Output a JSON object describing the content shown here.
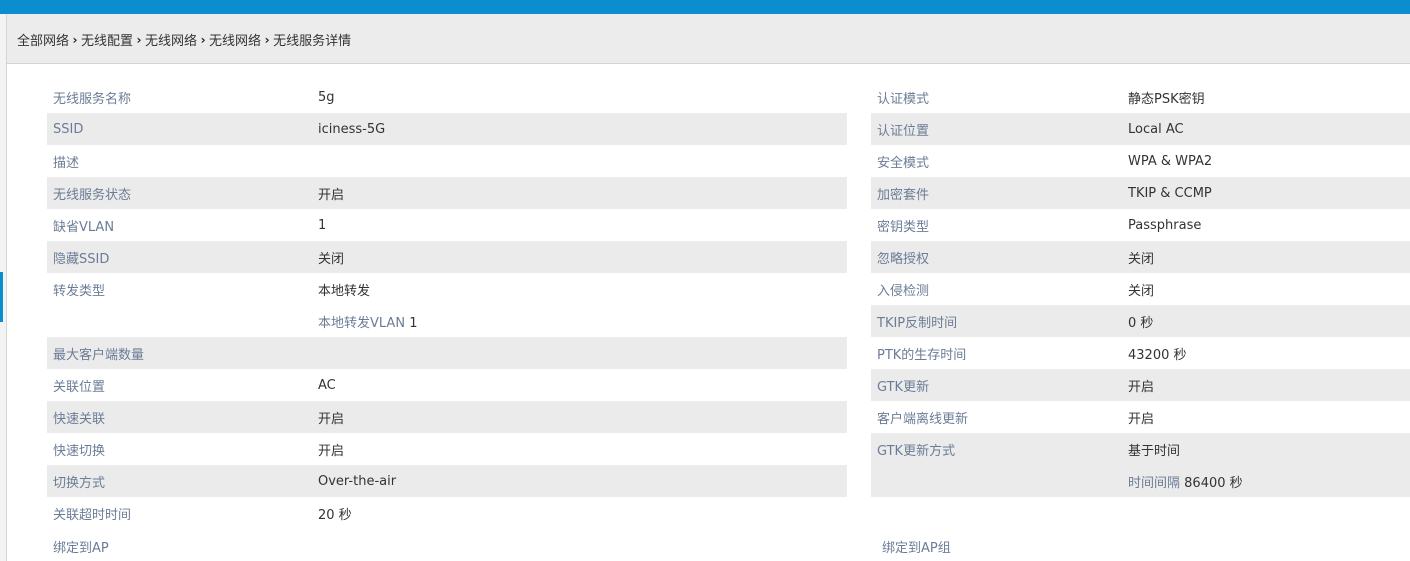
{
  "colors": {
    "topbar": "#0a8ed0",
    "header_bg": "#ececec",
    "row_alt_bg": "#ebebeb",
    "label_text": "#6c7c96",
    "value_text": "#333333"
  },
  "icons": {
    "breadcrumb_separator": "chevron-right-icon"
  },
  "breadcrumb": [
    "全部网络",
    "无线配置",
    "无线网络",
    "无线网络",
    "无线服务详情"
  ],
  "left_rows": [
    {
      "label": "无线服务名称",
      "value": "5g"
    },
    {
      "label": "SSID",
      "value": "iciness-5G"
    },
    {
      "label": "描述",
      "value": ""
    },
    {
      "label": "无线服务状态",
      "value": "开启"
    },
    {
      "label": "缺省VLAN",
      "value": "1"
    },
    {
      "label": "隐藏SSID",
      "value": "关闭"
    },
    {
      "label": "转发类型",
      "value": "本地转发"
    },
    {
      "label": "",
      "sublabel": "本地转发VLAN",
      "value": "1"
    },
    {
      "label": "最大客户端数量",
      "value": ""
    },
    {
      "label": "关联位置",
      "value": "AC"
    },
    {
      "label": "快速关联",
      "value": "开启"
    },
    {
      "label": "快速切换",
      "value": "开启"
    },
    {
      "label": "切换方式",
      "value": "Over-the-air"
    },
    {
      "label": "关联超时时间",
      "value": "20 秒"
    }
  ],
  "right_rows": [
    {
      "label": "认证模式",
      "value": "静态PSK密钥"
    },
    {
      "label": "认证位置",
      "value": "Local AC"
    },
    {
      "label": "安全模式",
      "value": "WPA & WPA2"
    },
    {
      "label": "加密套件",
      "value": "TKIP & CCMP"
    },
    {
      "label": "密钥类型",
      "value": "Passphrase"
    },
    {
      "label": "忽略授权",
      "value": "关闭"
    },
    {
      "label": "入侵检测",
      "value": "关闭"
    },
    {
      "label": "TKIP反制时间",
      "value": "0 秒"
    },
    {
      "label": "PTK的生存时间",
      "value": "43200 秒"
    },
    {
      "label": "GTK更新",
      "value": "开启"
    },
    {
      "label": "客户端离线更新",
      "value": "开启"
    },
    {
      "label": "GTK更新方式",
      "value": "基于时间"
    },
    {
      "label": "",
      "sublabel": "时间间隔",
      "value": "86400 秒"
    }
  ],
  "bind_ap_label": "绑定到AP",
  "bind_ap_group_label": "绑定到AP组"
}
